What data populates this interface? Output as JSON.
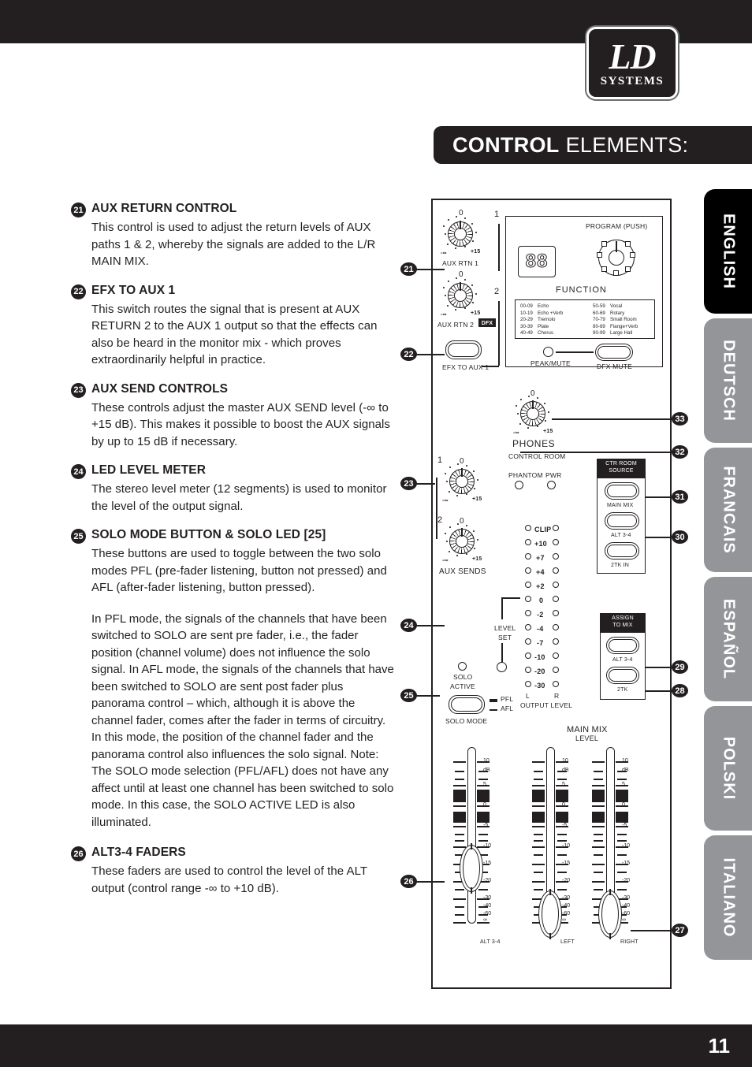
{
  "header": {
    "logo_primary": "LD",
    "logo_secondary": "SYSTEMS",
    "title_strong": "CONTROL",
    "title_light": "ELEMENTS:"
  },
  "language_tabs": [
    {
      "label": "ENGLISH",
      "active": true
    },
    {
      "label": "DEUTSCH",
      "active": false
    },
    {
      "label": "FRANCAIS",
      "active": false
    },
    {
      "label": "ESPAÑOL",
      "active": false
    },
    {
      "label": "POLSKI",
      "active": false
    },
    {
      "label": "ITALIANO",
      "active": false
    }
  ],
  "items": [
    {
      "number": "21",
      "title": "AUX RETURN CONTROL",
      "body": "This control is used to adjust the return levels of AUX paths 1 & 2, whereby the signals are added to the L/R MAIN MIX."
    },
    {
      "number": "22",
      "title": "EFX TO AUX 1",
      "body": "This switch routes the signal that is present at AUX RETURN 2 to the AUX 1 output so that the effects can also be heard in the monitor mix - which proves extraordinarily helpful in practice."
    },
    {
      "number": "23",
      "title": "AUX SEND CONTROLS",
      "body": "These controls adjust the master AUX SEND level (-∞ to +15 dB). This makes it possible to boost the AUX signals by up to 15 dB if necessary."
    },
    {
      "number": "24",
      "title": "LED LEVEL METER",
      "body": "The stereo level meter (12 segments) is used to monitor the level of the output signal."
    },
    {
      "number": "25",
      "title": "SOLO MODE BUTTON & SOLO LED [25]",
      "body": "These buttons are used to toggle between the two solo modes PFL (pre-fader listening, button not pressed) and AFL (after-fader listening, button pressed).",
      "body_extra": "In PFL mode, the signals of the channels that have been switched to SOLO are sent pre fader, i.e., the fader position (channel volume) does not influence the solo signal. In AFL mode, the signals of the channels that have been switched to SOLO are sent post fader plus panorama control – which, although it is above the channel fader, comes after the fader in terms of circuitry. In this mode, the position of the channel fader and the panorama control also influences the solo signal. Note: The SOLO mode selection (PFL/AFL) does not have any affect until at least one channel has been switched to solo mode. In this case, the SOLO ACTIVE LED is also illuminated."
    },
    {
      "number": "26",
      "title": "ALT3-4 FADERS",
      "body": "These faders are used to control the level of the ALT output (control range -∞ to +10 dB)."
    }
  ],
  "diagram": {
    "callouts_left": [
      "21",
      "22",
      "23",
      "24",
      "25",
      "26"
    ],
    "callouts_right": [
      "33",
      "32",
      "31",
      "30",
      "29",
      "28",
      "27"
    ],
    "knob_min": "-∞",
    "knob_max": "+15",
    "knob_center": "0",
    "aux_rtn_1_label": "AUX RTN 1",
    "aux_rtn_2_label": "AUX RTN 2",
    "dfx_badge": "DFX",
    "efx_to_aux_1_label": "EFX TO AUX 1",
    "group_1": "1",
    "group_2": "2",
    "program_label": "PROGRAM (PUSH)",
    "seg_display": "88",
    "function_label": "FUNCTION",
    "function_table_left": [
      {
        "range": "00-09",
        "name": "Echo"
      },
      {
        "range": "10-19",
        "name": "Echo  +Verb"
      },
      {
        "range": "20-29",
        "name": "Tremolo"
      },
      {
        "range": "30-39",
        "name": "Plate"
      },
      {
        "range": "40-49",
        "name": "Chorus"
      }
    ],
    "function_table_right": [
      {
        "range": "50-59",
        "name": "Vocal"
      },
      {
        "range": "60-69",
        "name": "Rotary"
      },
      {
        "range": "70-79",
        "name": "Small Room"
      },
      {
        "range": "80-89",
        "name": "Flange+Verb"
      },
      {
        "range": "90-99",
        "name": "Large Hall"
      }
    ],
    "peak_mute_label": "PEAK/MUTE",
    "dfx_mute_label": "DFX MUTE",
    "phones_label": "PHONES",
    "control_room_label": "CONTROL ROOM",
    "phantom_label": "PHANTOM",
    "pwr_label": "PWR",
    "aux_sends_label": "AUX SENDS",
    "ctr_room_source_line1": "CTR ROOM",
    "ctr_room_source_line2": "SOURCE",
    "ctr_room_buttons": [
      "MAIN MIX",
      "ALT 3-4",
      "2TK IN"
    ],
    "assign_to_mix_line1": "ASSIGN",
    "assign_to_mix_line2": "TO MIX",
    "assign_buttons": [
      "ALT 3-4",
      "2TK"
    ],
    "meter_labels": [
      "CLIP",
      "+10",
      "+7",
      "+4",
      "+2",
      "0",
      "-2",
      "-4",
      "-7",
      "-10",
      "-20",
      "-30"
    ],
    "meter_left": "L",
    "meter_right": "R",
    "output_level_label": "OUTPUT LEVEL",
    "solo_active_line1": "SOLO",
    "solo_active_line2": "ACTIVE",
    "level_set_line1": "LEVEL",
    "level_set_line2": "SET",
    "solo_mode_label": "SOLO MODE",
    "pfl_label": "PFL",
    "afl_label": "AFL",
    "main_mix_line1": "MAIN MIX",
    "main_mix_line2": "LEVEL",
    "fader_scale": [
      "10",
      "dB",
      "5",
      "0",
      "-5",
      "-10",
      "-15",
      "-20",
      "-30",
      "-40",
      "-60",
      "∞"
    ],
    "fader_names": [
      "ALT 3-4",
      "LEFT",
      "RIGHT"
    ]
  },
  "footer": {
    "page_number": "11"
  }
}
